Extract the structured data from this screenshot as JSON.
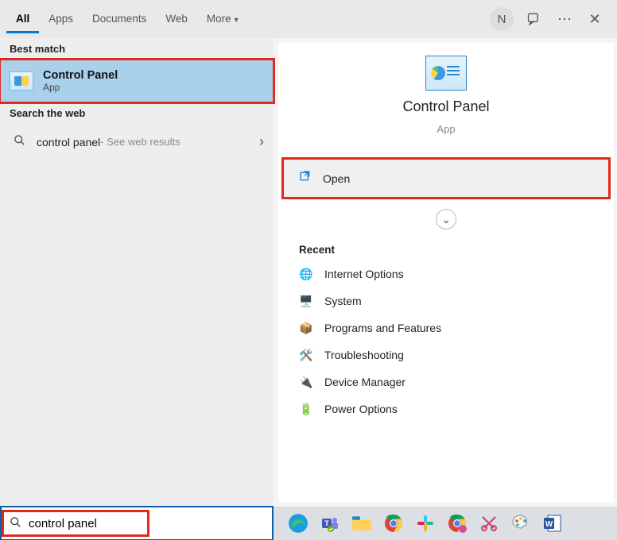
{
  "tabs": [
    "All",
    "Apps",
    "Documents",
    "Web",
    "More"
  ],
  "active_tab": 0,
  "user_initial": "N",
  "left": {
    "best_match_label": "Best match",
    "best_match": {
      "title": "Control Panel",
      "subtitle": "App"
    },
    "search_web_label": "Search the web",
    "web_result": {
      "query": "control panel",
      "suffix": " - See web results"
    }
  },
  "pane": {
    "title": "Control Panel",
    "subtitle": "App",
    "open_label": "Open",
    "recent_label": "Recent",
    "recent": [
      {
        "icon": "🌐",
        "label": "Internet Options"
      },
      {
        "icon": "🖥️",
        "label": "System"
      },
      {
        "icon": "📦",
        "label": "Programs and Features"
      },
      {
        "icon": "🛠️",
        "label": "Troubleshooting"
      },
      {
        "icon": "🔌",
        "label": "Device Manager"
      },
      {
        "icon": "🔋",
        "label": "Power Options"
      }
    ]
  },
  "search_value": "control panel",
  "taskbar_apps": [
    "edge",
    "teams",
    "explorer",
    "chrome",
    "slack",
    "chrome2",
    "snip",
    "paint",
    "word"
  ]
}
